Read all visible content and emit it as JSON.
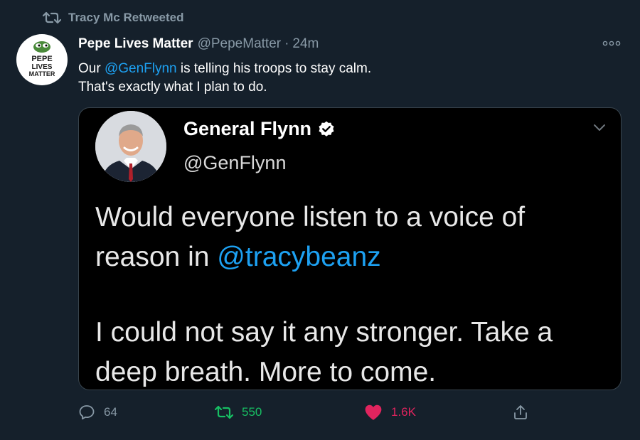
{
  "retweet_banner": {
    "text": "Tracy Mc Retweeted"
  },
  "tweet": {
    "author_name": "Pepe Lives Matter",
    "author_handle": "@PepeMatter",
    "separator": "·",
    "timestamp": "24m",
    "avatar_text_line1": "PEPE",
    "avatar_text_line2": "LIVES",
    "avatar_text_line3": "MATTER",
    "text_part1": "Our ",
    "mention": "@GenFlynn",
    "text_part2": " is telling his troops to stay calm.",
    "text_line2": "That's exactly what I plan to do."
  },
  "embedded": {
    "name": "General Flynn",
    "handle": "@GenFlynn",
    "line1": "Would everyone listen to a voice of",
    "line2_prefix": "reason in ",
    "line2_mention": "@tracybeanz",
    "line3": "I could not say it any stronger. Take a",
    "line4": "deep breath. More to come."
  },
  "actions": {
    "reply_count": "64",
    "retweet_count": "550",
    "like_count": "1.6K"
  },
  "colors": {
    "background": "#15202b",
    "accent_blue": "#1da1f2",
    "retweet_green": "#17bf63",
    "like_pink": "#e0245e",
    "muted_gray": "#8899a6"
  },
  "icons": {
    "retweet_banner": "retweet-icon",
    "more": "more-icon",
    "verified": "verified-badge-icon",
    "chevron": "chevron-down-icon",
    "reply": "reply-icon",
    "retweet": "retweet-icon",
    "like": "heart-icon",
    "share": "share-icon"
  }
}
